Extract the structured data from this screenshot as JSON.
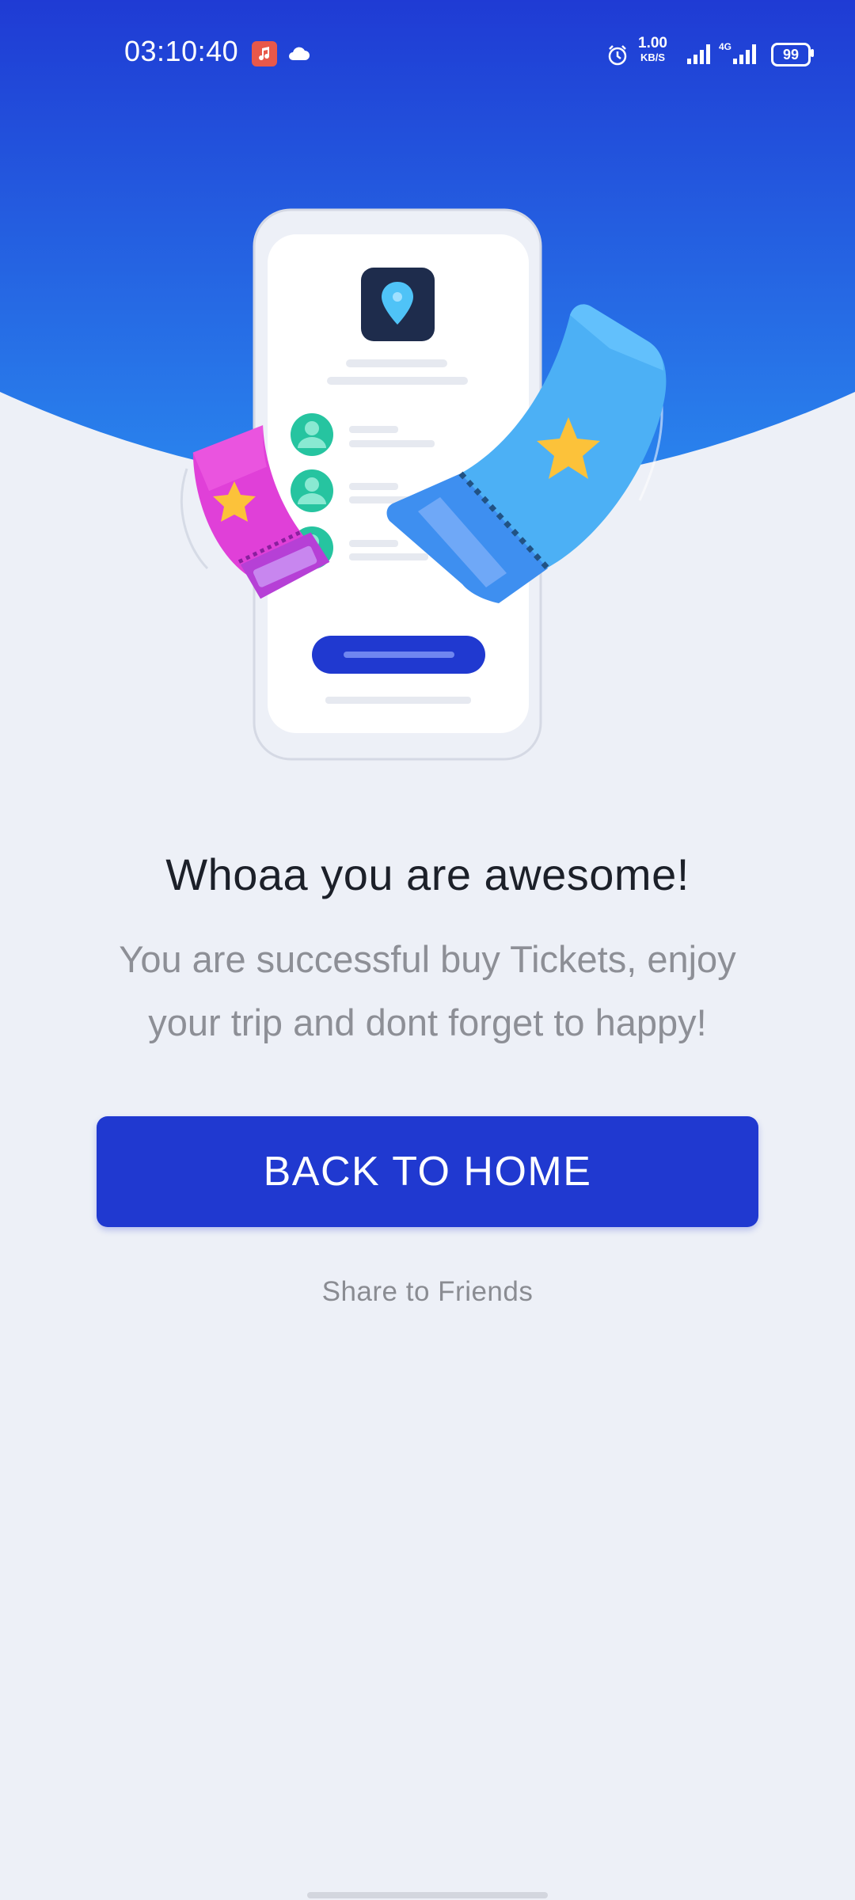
{
  "status_bar": {
    "time": "03:10:40",
    "network_speed_value": "1.00",
    "network_speed_unit": "KB/S",
    "network_type": "4G",
    "battery_level": "99"
  },
  "content": {
    "title": "Whoaa you are awesome!",
    "subtitle": "You are successful buy Tickets, enjoy your trip and dont forget to happy!",
    "primary_button_label": "BACK TO HOME",
    "secondary_link_label": "Share to Friends"
  },
  "colors": {
    "brand_blue": "#2039d0",
    "gradient_top": "#1f3fd6",
    "gradient_bottom": "#2680ea",
    "background": "#edf0f7",
    "ticket_pink": "#e040d8",
    "ticket_blue": "#4fb3f6",
    "star_yellow": "#fcc23a",
    "avatar_teal": "#26c4a0"
  },
  "icons": [
    "music-notification-icon",
    "cloud-icon",
    "alarm-icon",
    "signal-icon",
    "battery-icon",
    "location-pin-icon",
    "star-icon",
    "user-avatar-icon"
  ]
}
